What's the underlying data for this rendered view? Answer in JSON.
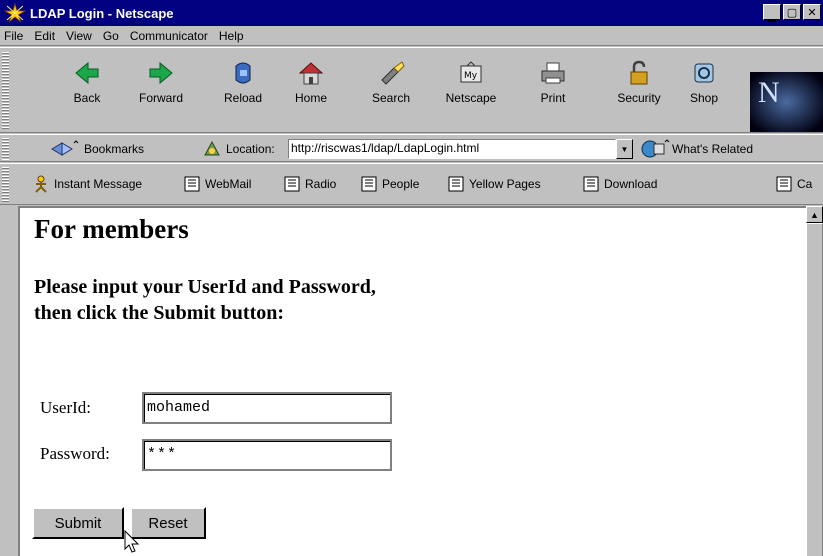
{
  "window": {
    "title": "LDAP Login - Netscape"
  },
  "menu": [
    {
      "label": "File"
    },
    {
      "label": "Edit"
    },
    {
      "label": "View"
    },
    {
      "label": "Go"
    },
    {
      "label": "Communicator"
    },
    {
      "label": "Help"
    }
  ],
  "toolbar": {
    "back": "Back",
    "forward": "Forward",
    "reload": "Reload",
    "home": "Home",
    "search": "Search",
    "netscape": "Netscape",
    "print": "Print",
    "security": "Security",
    "shop": "Shop"
  },
  "location": {
    "bookmarks": "Bookmarks",
    "label": "Location:",
    "url": "http://riscwas1/ldap/LdapLogin.html",
    "whats_related": "What's Related"
  },
  "personal": [
    {
      "label": "Instant Message"
    },
    {
      "label": "WebMail"
    },
    {
      "label": "Radio"
    },
    {
      "label": "People"
    },
    {
      "label": "Yellow Pages"
    },
    {
      "label": "Download"
    },
    {
      "label": "Ca"
    }
  ],
  "page": {
    "heading": "For members",
    "instruction_line1": "Please input your UserId and Password,",
    "instruction_line2": "then click the Submit button:",
    "userid_label": "UserId:",
    "userid_value": "mohamed",
    "password_label": "Password:",
    "password_value": "***",
    "submit_label": "Submit",
    "reset_label": "Reset"
  },
  "colors": {
    "titlebar": "#000080",
    "chrome": "#c0c0c0"
  }
}
